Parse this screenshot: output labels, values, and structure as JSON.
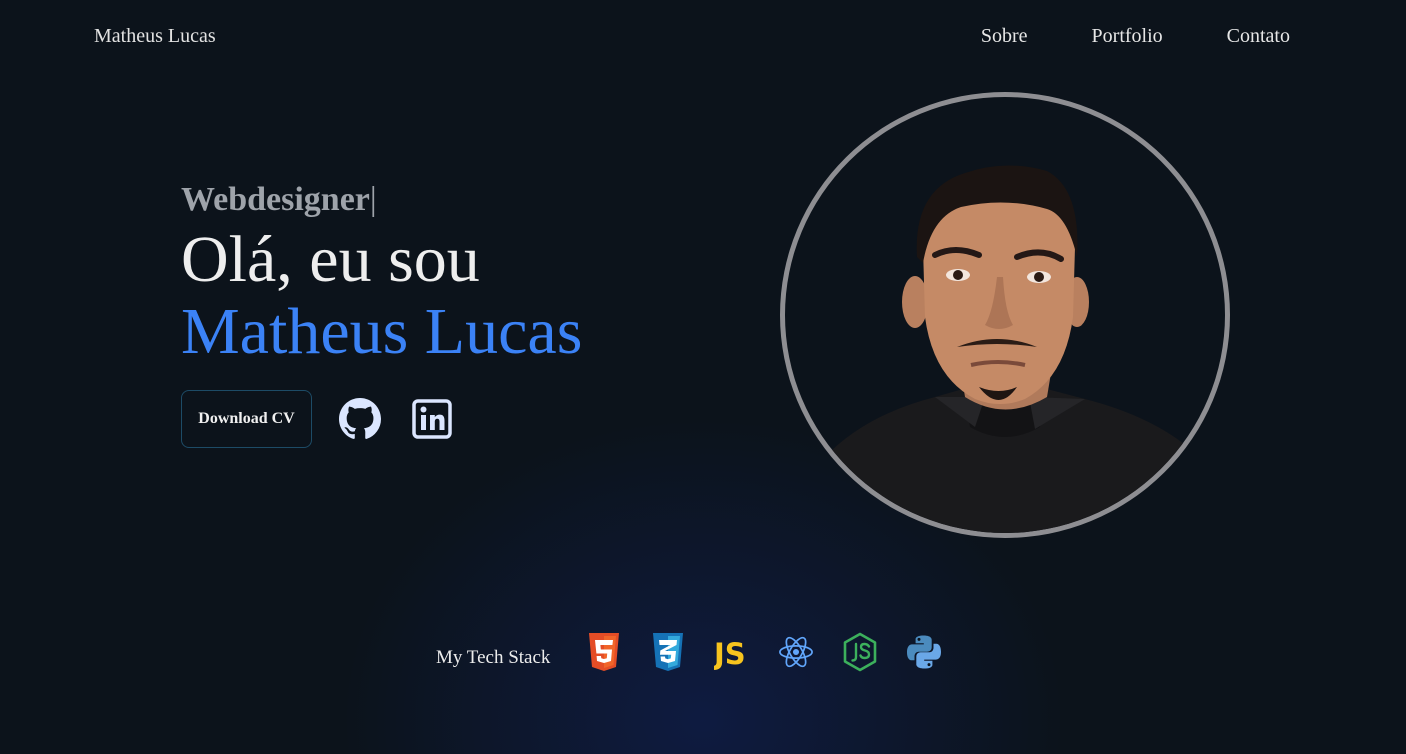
{
  "header": {
    "brand": "Matheus Lucas",
    "nav": [
      "Sobre",
      "Portfolio",
      "Contato"
    ]
  },
  "hero": {
    "role": "Webdesigner",
    "caret": "|",
    "greeting": "Olá, eu sou",
    "name": "Matheus Lucas",
    "download_label": "Download CV",
    "social_icons": [
      "github-icon",
      "linkedin-icon"
    ]
  },
  "tech_stack": {
    "label": "My Tech Stack",
    "icons": [
      "html5-icon",
      "css3-icon",
      "javascript-icon",
      "react-icon",
      "nodejs-icon",
      "python-icon"
    ],
    "js_text": "JS"
  },
  "colors": {
    "background": "#0c131b",
    "accent": "#3b82f6",
    "role_text": "#9ea3aa",
    "avatar_border": "#8e8e92",
    "html5": "#e44d26",
    "css3": "#1572b6",
    "javascript": "#f7df1e",
    "react": "#61dafb",
    "nodejs": "#3c9e4c",
    "python": "#4b8bbe"
  }
}
